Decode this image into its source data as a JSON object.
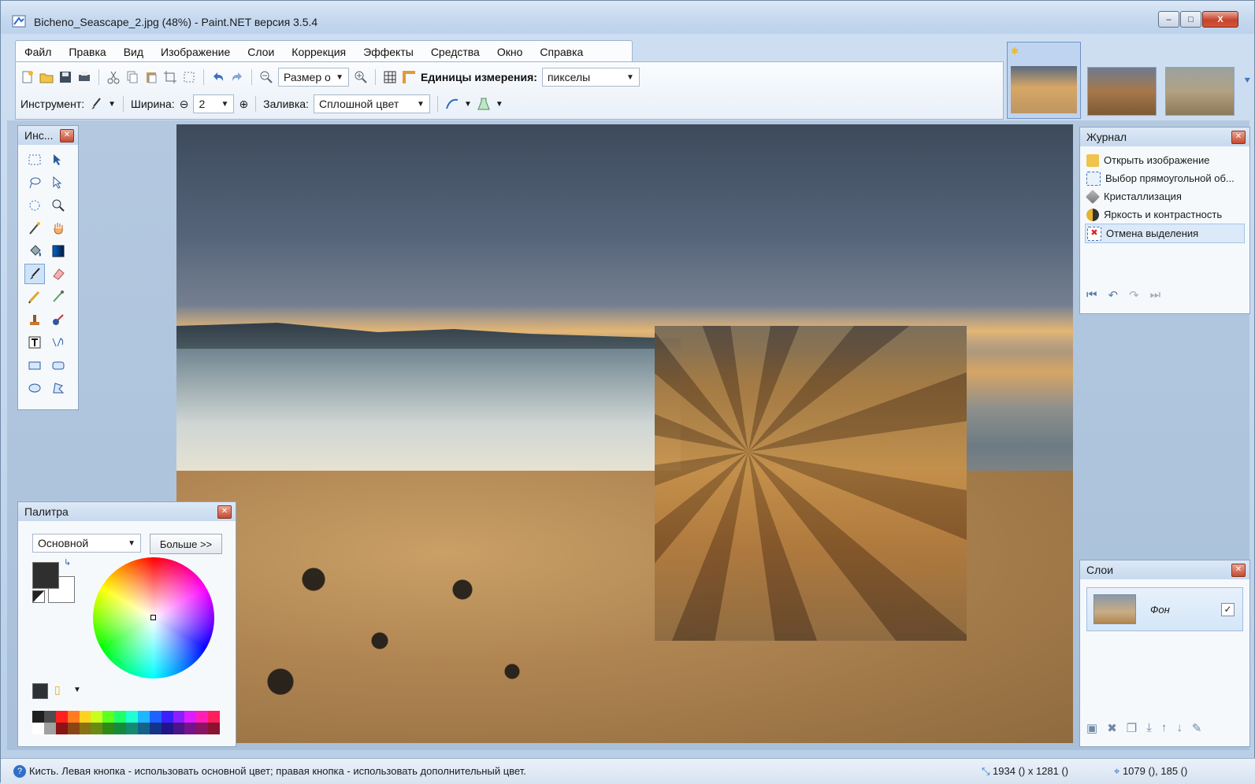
{
  "window": {
    "title": "Bicheno_Seascape_2.jpg (48%) - Paint.NET версия 3.5.4",
    "controls": {
      "minimize": "–",
      "maximize": "□",
      "close": "X"
    }
  },
  "menu": [
    "Файл",
    "Правка",
    "Вид",
    "Изображение",
    "Слои",
    "Коррекция",
    "Эффекты",
    "Средства",
    "Окно",
    "Справка"
  ],
  "toolbar": {
    "zoom_combo": "Размер о",
    "units_label": "Единицы измерения:",
    "units_value": "пикселы",
    "tool_label": "Инструмент:",
    "width_label": "Ширина:",
    "width_value": "2",
    "fill_label": "Заливка:",
    "fill_value": "Сплошной цвет"
  },
  "tools_panel": {
    "title": "Инс..."
  },
  "history": {
    "title": "Журнал",
    "items": [
      "Открыть изображение",
      "Выбор прямоугольной об...",
      "Кристаллизация",
      "Яркость и контрастность",
      "Отмена выделения"
    ],
    "selected_index": 4
  },
  "layers": {
    "title": "Слои",
    "items": [
      {
        "name": "Фон",
        "visible": true
      }
    ]
  },
  "palette": {
    "title": "Палитра",
    "palette_select": "Основной",
    "more_button": "Больше >>",
    "primary_color": "#2f2f2f",
    "secondary_color": "#ffffff"
  },
  "status": {
    "help_text": "Кисть. Левая кнопка - использовать основной цвет; правая кнопка - использовать дополнительный цвет.",
    "image_size": "1934 () x 1281 ()",
    "cursor_pos": "1079 (), 185 ()"
  }
}
